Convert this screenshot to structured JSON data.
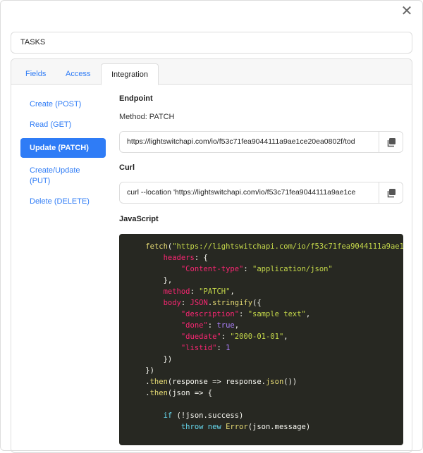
{
  "modal": {
    "close_icon": "close-icon",
    "title_value": "TASKS"
  },
  "tabs": [
    {
      "label": "Fields"
    },
    {
      "label": "Access"
    },
    {
      "label": "Integration",
      "active": true
    }
  ],
  "nav": [
    {
      "label": "Create (POST)"
    },
    {
      "label": "Read (GET)"
    },
    {
      "label": "Update (PATCH)",
      "active": true
    },
    {
      "label": "Create/Update (PUT)"
    },
    {
      "label": "Delete (DELETE)"
    }
  ],
  "endpoint": {
    "heading": "Endpoint",
    "method": "Method: PATCH",
    "url": "https://lightswitchapi.com/io/f53c71fea9044111a9ae1ce20ea0802f/tod",
    "copy_icon": "copy-icon"
  },
  "curl": {
    "heading": "Curl",
    "value": "curl --location 'https://lightswitchapi.com/io/f53c71fea9044111a9ae1ce",
    "copy_icon": "copy-icon"
  },
  "javascript": {
    "heading": "JavaScript",
    "colors": {
      "p": "#f8f8f2",
      "s": "#c5d84a",
      "k": "#f92672",
      "n": "#ae81ff",
      "f": "#e6db74",
      "w": "#66d9ef"
    },
    "lines": [
      [
        [
          "p",
          "    "
        ],
        [
          "f",
          "fetch"
        ],
        [
          "p",
          "("
        ],
        [
          "s",
          "\"https://lightswitchapi.com/io/f53c71fea9044111a9ae1"
        ]
      ],
      [
        [
          "p",
          "        "
        ],
        [
          "k",
          "headers"
        ],
        [
          "p",
          ": {"
        ]
      ],
      [
        [
          "p",
          "            "
        ],
        [
          "k",
          "\"Content-type\""
        ],
        [
          "p",
          ": "
        ],
        [
          "s",
          "\"application/json\""
        ]
      ],
      [
        [
          "p",
          "        },"
        ]
      ],
      [
        [
          "p",
          "        "
        ],
        [
          "k",
          "method"
        ],
        [
          "p",
          ": "
        ],
        [
          "s",
          "\"PATCH\""
        ],
        [
          "p",
          ","
        ]
      ],
      [
        [
          "p",
          "        "
        ],
        [
          "k",
          "body"
        ],
        [
          "p",
          ": "
        ],
        [
          "k",
          "JSON"
        ],
        [
          "p",
          "."
        ],
        [
          "f",
          "stringify"
        ],
        [
          "p",
          "({"
        ]
      ],
      [
        [
          "p",
          "            "
        ],
        [
          "k",
          "\"description\""
        ],
        [
          "p",
          ": "
        ],
        [
          "s",
          "\"sample text\""
        ],
        [
          "p",
          ","
        ]
      ],
      [
        [
          "p",
          "            "
        ],
        [
          "k",
          "\"done\""
        ],
        [
          "p",
          ": "
        ],
        [
          "n",
          "true"
        ],
        [
          "p",
          ","
        ]
      ],
      [
        [
          "p",
          "            "
        ],
        [
          "k",
          "\"duedate\""
        ],
        [
          "p",
          ": "
        ],
        [
          "s",
          "\"2000-01-01\""
        ],
        [
          "p",
          ","
        ]
      ],
      [
        [
          "p",
          "            "
        ],
        [
          "k",
          "\"listid\""
        ],
        [
          "p",
          ": "
        ],
        [
          "n",
          "1"
        ]
      ],
      [
        [
          "p",
          "        })"
        ]
      ],
      [
        [
          "p",
          "    })"
        ]
      ],
      [
        [
          "p",
          "    ."
        ],
        [
          "f",
          "then"
        ],
        [
          "p",
          "(response => response."
        ],
        [
          "f",
          "json"
        ],
        [
          "p",
          "())"
        ]
      ],
      [
        [
          "p",
          "    ."
        ],
        [
          "f",
          "then"
        ],
        [
          "p",
          "(json => {"
        ]
      ],
      [
        [
          "p",
          ""
        ]
      ],
      [
        [
          "p",
          "        "
        ],
        [
          "w",
          "if"
        ],
        [
          "p",
          " (!json.success)"
        ]
      ],
      [
        [
          "p",
          "            "
        ],
        [
          "w",
          "throw"
        ],
        [
          "p",
          " "
        ],
        [
          "w",
          "new"
        ],
        [
          "p",
          " "
        ],
        [
          "f",
          "Error"
        ],
        [
          "p",
          "(json.message)"
        ]
      ]
    ]
  }
}
